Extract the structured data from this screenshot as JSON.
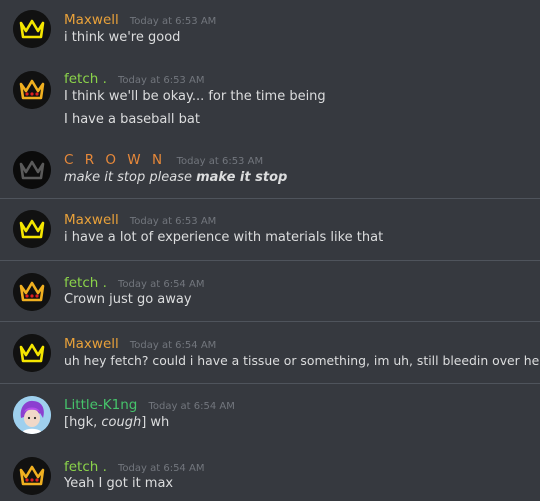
{
  "colors": {
    "background": "#36393f",
    "maxwell": "#e8a13a",
    "fetch": "#8bd34a",
    "crown": "#e6883a",
    "little_king": "#46c46b",
    "timestamp": "#72767d",
    "text": "#dcddde"
  },
  "messages": [
    {
      "username": "Maxwell",
      "timestamp": "Today at 6:53 AM",
      "avatar_icon": "yellow-crown-icon",
      "lines": [
        "i think we're good"
      ]
    },
    {
      "username": "fetch .",
      "timestamp": "Today at 6:53 AM",
      "avatar_icon": "orange-crown-red-gems-icon",
      "lines": [
        "I think we'll be okay... for the time being",
        "I have a baseball bat"
      ]
    },
    {
      "username": "C R O W N",
      "timestamp": "Today at 6:53 AM",
      "avatar_icon": "black-crown-icon",
      "line_italic": "make it stop please ",
      "line_bold_italic": "make it stop"
    },
    {
      "username": "Maxwell",
      "timestamp": "Today at 6:53 AM",
      "avatar_icon": "yellow-crown-icon",
      "lines": [
        "i have a lot of experience with materials like that"
      ]
    },
    {
      "username": "fetch .",
      "timestamp": "Today at 6:54 AM",
      "avatar_icon": "orange-crown-red-gems-icon",
      "lines": [
        "Crown just go away"
      ]
    },
    {
      "username": "Maxwell",
      "timestamp": "Today at 6:54 AM",
      "avatar_icon": "yellow-crown-icon",
      "lines": [
        "uh hey fetch? could i have a tissue or something, im uh, still bleedin over here"
      ]
    },
    {
      "username": "Little-K1ng",
      "timestamp": "Today at 6:54 AM",
      "avatar_icon": "purple-hair-character-icon",
      "line_pre": "[hgk, ",
      "line_italic": "cough",
      "line_post": "] wh"
    },
    {
      "username": "fetch .",
      "timestamp": "Today at 6:54 AM",
      "avatar_icon": "orange-crown-red-gems-icon",
      "lines": [
        "Yeah I got it max"
      ]
    }
  ]
}
